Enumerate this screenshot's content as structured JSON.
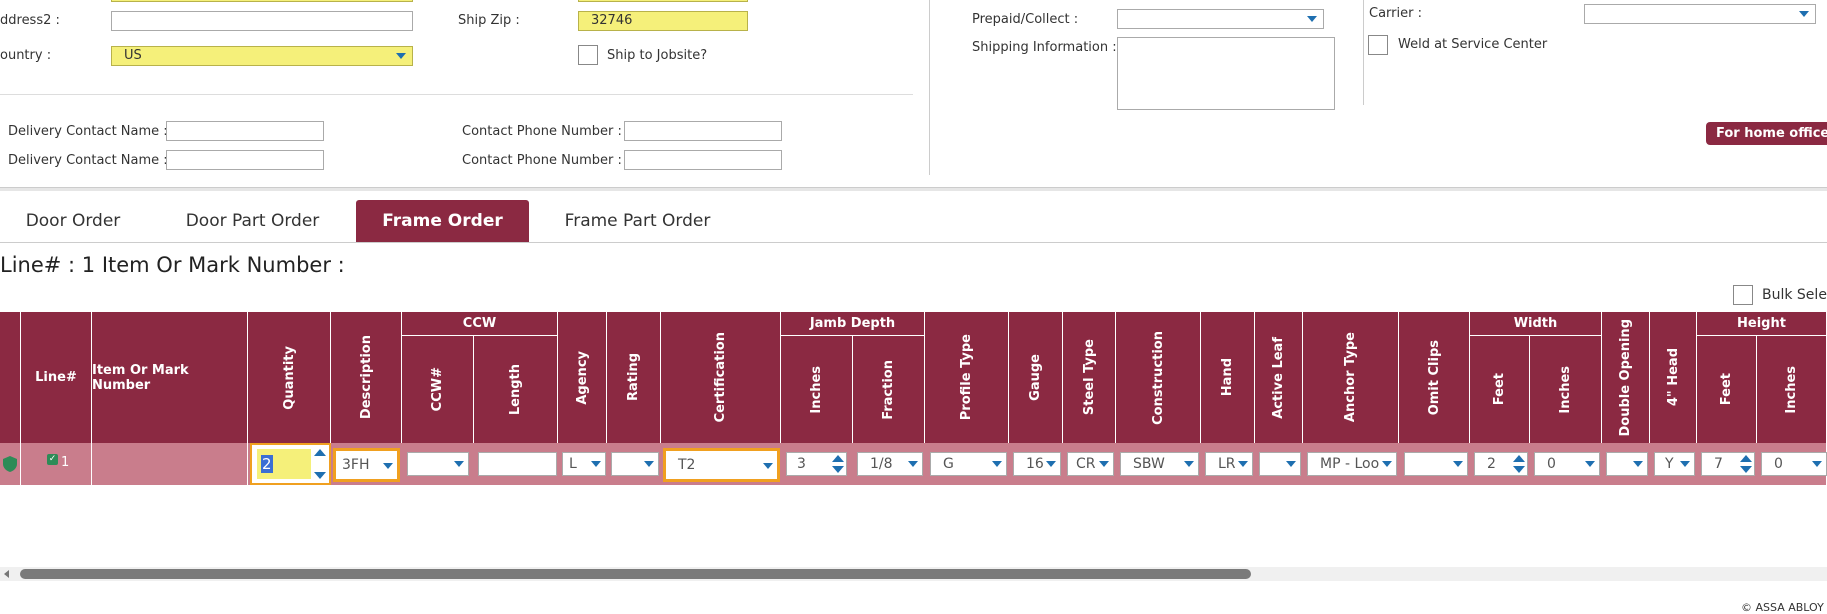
{
  "form": {
    "address2_label": "ddress2 :",
    "country_label": "ountry :",
    "country_value": "US",
    "ship_zip_label": "Ship Zip :",
    "ship_zip_value": "32746",
    "ship_to_jobsite_label": "Ship to Jobsite?",
    "prepaid_collect_label": "Prepaid/Collect :",
    "shipping_info_label": "Shipping Information :",
    "carrier_label": "Carrier :",
    "weld_label": "Weld at Service Center",
    "home_office_button": "For home office u",
    "delivery_contact_1_label": "Delivery Contact Name :",
    "delivery_contact_2_label": "Delivery Contact Name :",
    "contact_phone_1_label": "Contact Phone Number :",
    "contact_phone_2_label": "Contact Phone Number :"
  },
  "tabs": [
    {
      "label": "Door Order",
      "active": false
    },
    {
      "label": "Door Part Order",
      "active": false
    },
    {
      "label": "Frame Order",
      "active": true
    },
    {
      "label": "Frame Part Order",
      "active": false
    }
  ],
  "line_header": "Line# : 1 Item Or Mark Number :",
  "bulk_select_label": "Bulk Sele",
  "grid": {
    "group_headers": {
      "ccw": "CCW",
      "jamb_depth": "Jamb Depth",
      "width": "Width",
      "height": "Height"
    },
    "columns": {
      "line": "Line#",
      "item_mark": "Item Or Mark Number",
      "quantity": "Quantity",
      "description": "Description",
      "ccw_num": "CCW#",
      "length": "Length",
      "agency": "Agency",
      "rating": "Rating",
      "certification": "Certification",
      "jamb_inches": "Inches",
      "jamb_fraction": "Fraction",
      "profile_type": "Profile Type",
      "gauge": "Gauge",
      "steel_type": "Steel Type",
      "construction": "Construction",
      "hand": "Hand",
      "active_leaf": "Active Leaf",
      "anchor_type": "Anchor Type",
      "omit_clips": "Omit Clips",
      "width_feet": "Feet",
      "width_inches": "Inches",
      "double_opening": "Double Opening",
      "four_head": "4\" Head",
      "height_feet": "Feet",
      "height_inches": "Inches"
    },
    "row": {
      "line": "1",
      "quantity": "2",
      "description": "3FH",
      "ccw_num": "",
      "length": "",
      "agency": "L",
      "rating": "",
      "certification": "T2",
      "jamb_inches": "3",
      "jamb_fraction": "1/8",
      "profile_type": "G",
      "gauge": "16",
      "steel_type": "CR",
      "construction": "SBW",
      "hand": "LR",
      "active_leaf": "",
      "anchor_type": "MP - Loo",
      "omit_clips": "",
      "width_feet": "2",
      "width_inches": "0",
      "double_opening": "",
      "four_head": "Y",
      "height_feet": "7",
      "height_inches": "0"
    }
  },
  "footer": "© ASSA ABLOY",
  "colors": {
    "brand": "#8b2942",
    "highlight_yellow": "#f5f07a",
    "orange_focus": "#f0a020",
    "link_blue": "#1e6fb0"
  }
}
